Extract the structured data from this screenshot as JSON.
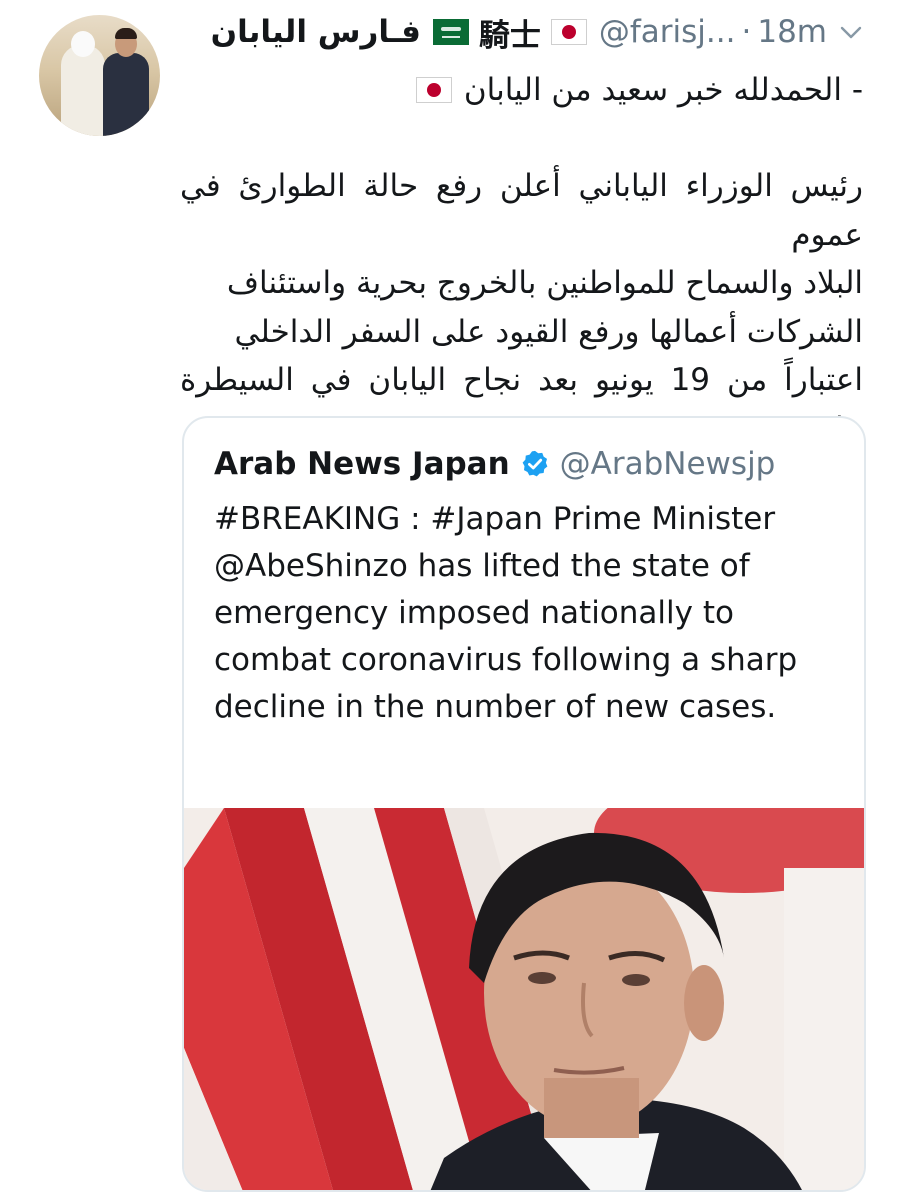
{
  "tweet": {
    "display_name": "فـارس اليابان",
    "display_name_suffix": "騎士",
    "handle": "@farisj...",
    "separator": "·",
    "time": "18m",
    "lead_line": "- الحمدلله خبر سعيد من اليابان",
    "body": "رئيس الوزراء الياباني أعلن رفع حالة الطوارئ في عموم\nالبلاد والسماح للمواطنين بالخروج بحرية واستئناف\nالشركات أعمالها ورفع القيود على السفر الداخلي\nاعتباراً من 19 يونيو بعد نجاح اليابان في السيطرة على\nانتشار الفايروس وتسجيل أدنى إصابات مؤخراً",
    "icons": [
      "avatar",
      "japan-flag-icon",
      "saudi-flag-icon",
      "chevron-down-icon"
    ]
  },
  "quoted_tweet": {
    "author_name": "Arab News Japan",
    "verified": true,
    "handle": "@ArabNewsjp",
    "text": "#BREAKING : #Japan Prime Minister @AbeShinzo has lifted the state of emergency imposed nationally to combat coronavirus following a sharp decline in the number of new cases.",
    "media": "photo-man-before-flags"
  },
  "colors": {
    "text": "#14171a",
    "secondary": "#657786",
    "border": "#e1e8ed",
    "verified_blue": "#1da1f2",
    "japan_red": "#bc002d"
  }
}
